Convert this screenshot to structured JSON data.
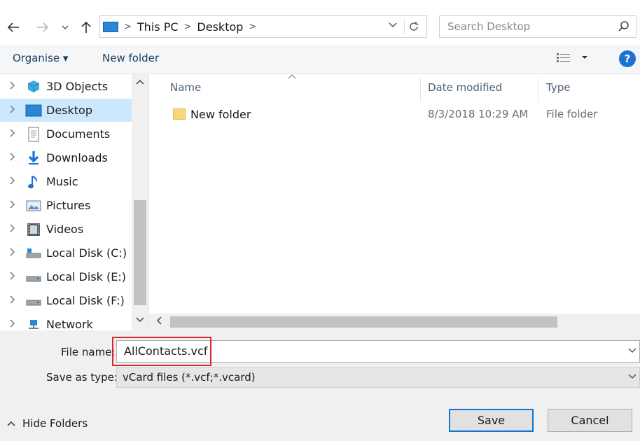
{
  "address_bar": {
    "breadcrumbs": [
      "This PC",
      "Desktop"
    ],
    "search_placeholder": "Search Desktop"
  },
  "toolbar": {
    "organise_label": "Organise ▾",
    "new_folder_label": "New folder",
    "help_label": "?"
  },
  "nav_pane": {
    "items": [
      {
        "label": "3D Objects",
        "icon": "3d-objects-icon"
      },
      {
        "label": "Desktop",
        "icon": "desktop-icon",
        "selected": true
      },
      {
        "label": "Documents",
        "icon": "documents-icon"
      },
      {
        "label": "Downloads",
        "icon": "downloads-icon"
      },
      {
        "label": "Music",
        "icon": "music-icon"
      },
      {
        "label": "Pictures",
        "icon": "pictures-icon"
      },
      {
        "label": "Videos",
        "icon": "videos-icon"
      },
      {
        "label": "Local Disk (C:)",
        "icon": "system-drive-icon"
      },
      {
        "label": "Local Disk (E:)",
        "icon": "drive-icon"
      },
      {
        "label": "Local Disk (F:)",
        "icon": "drive-icon"
      },
      {
        "label": "Network",
        "icon": "network-icon"
      }
    ]
  },
  "file_list": {
    "columns": [
      "Name",
      "Date modified",
      "Type"
    ],
    "rows": [
      {
        "name": "New folder",
        "date_modified": "8/3/2018 10:29 AM",
        "type": "File folder"
      }
    ]
  },
  "form": {
    "file_name_label": "File name:",
    "file_name_value": "AllContacts.vcf",
    "save_type_label": "Save as type:",
    "save_type_value": "vCard files (*.vcf;*.vcard)",
    "hide_folders_label": "Hide Folders",
    "save_label": "Save",
    "cancel_label": "Cancel"
  },
  "colors": {
    "accent": "#0f74d2",
    "selection": "#cce8ff",
    "highlight_box": "#d8262c"
  }
}
